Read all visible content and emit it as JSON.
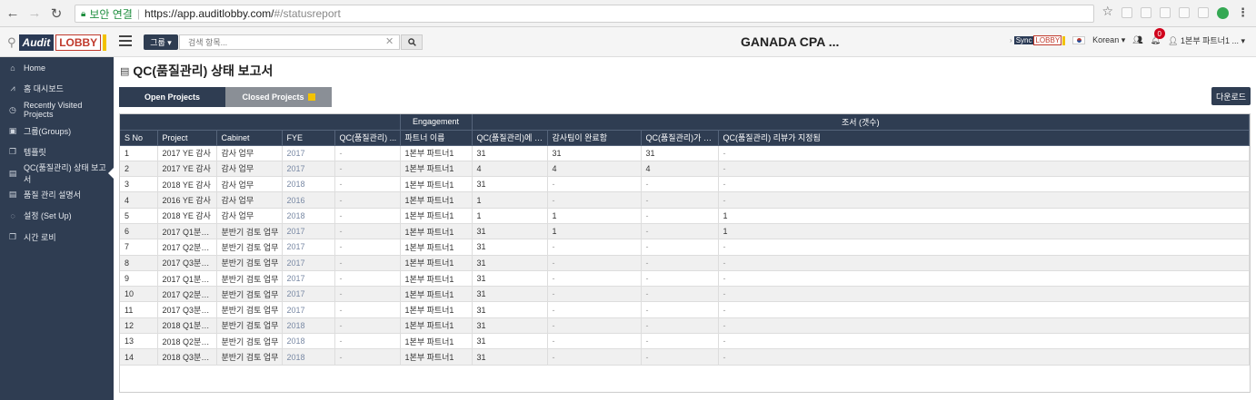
{
  "browser": {
    "secure_label": "보안 연결",
    "url_host": "https://app.auditlobby.com/",
    "url_hash": "#/statusreport"
  },
  "header": {
    "logo_audit": "Audit",
    "logo_lobby": "LOBBY",
    "group_select": "그룹 ▾",
    "search_placeholder": "검색 항목...",
    "firm_title": "GANADA CPA ...",
    "sync_prefix": "Sync",
    "sync_lobby": "LOBBY",
    "language": "Korean",
    "notification_count": "0",
    "user_name": "1본부 파트너1 ..."
  },
  "sidebar": {
    "items": [
      {
        "label": "Home",
        "icon": "home-icon",
        "glyph": "⌂"
      },
      {
        "label": "홈 대시보드",
        "icon": "chart-icon",
        "glyph": "⩘"
      },
      {
        "label": "Recently Visited Projects",
        "icon": "clock-icon",
        "glyph": "◷"
      },
      {
        "label": "그룹(Groups)",
        "icon": "group-icon",
        "glyph": "▣"
      },
      {
        "label": "템플릿",
        "icon": "template-icon",
        "glyph": "❐"
      },
      {
        "label": "QC(품질관리) 상태 보고서",
        "icon": "report-icon",
        "glyph": "▤"
      },
      {
        "label": "품질 관리 설명서",
        "icon": "manual-icon",
        "glyph": "▤"
      },
      {
        "label": "설정 (Set Up)",
        "icon": "settings-icon",
        "glyph": "◌"
      },
      {
        "label": "시간 로비",
        "icon": "time-icon",
        "glyph": "❐"
      }
    ]
  },
  "main": {
    "title": "QC(품질관리) 상태 보고서",
    "tab_open": "Open Projects",
    "tab_closed": "Closed Projects",
    "download": "다운로드",
    "group_headers": {
      "engagement": "Engagement",
      "survey": "조서 (갯수)"
    },
    "columns": [
      "S No",
      "Project",
      "Cabinet",
      "FYE",
      "QC(품질관리) ...",
      "파트너 이름",
      "QC(품질관리)에 지정...",
      "감사팀이 완료함",
      "QC(품질관리)가 리뷰...",
      "QC(품질관리) 리뷰가 지정됨"
    ],
    "rows": [
      [
        "1",
        "2017 YE 감사",
        "감사 업무",
        "2017",
        "-",
        "1본부 파트너1",
        "31",
        "31",
        "31",
        "-"
      ],
      [
        "2",
        "2017 YE 감사",
        "감사 업무",
        "2017",
        "-",
        "1본부 파트너1",
        "4",
        "4",
        "4",
        "-"
      ],
      [
        "3",
        "2018 YE 감사",
        "감사 업무",
        "2018",
        "-",
        "1본부 파트너1",
        "31",
        "-",
        "-",
        "-"
      ],
      [
        "4",
        "2016 YE 감사",
        "감사 업무",
        "2016",
        "-",
        "1본부 파트너1",
        "1",
        "-",
        "-",
        "-"
      ],
      [
        "5",
        "2018 YE 감사",
        "감사 업무",
        "2018",
        "-",
        "1본부 파트너1",
        "1",
        "1",
        "-",
        "1"
      ],
      [
        "6",
        "2017 Q1분기 ...",
        "분반기 검토 업무",
        "2017",
        "-",
        "1본부 파트너1",
        "31",
        "1",
        "-",
        "1"
      ],
      [
        "7",
        "2017 Q2분기 ...",
        "분반기 검토 업무",
        "2017",
        "-",
        "1본부 파트너1",
        "31",
        "-",
        "-",
        "-"
      ],
      [
        "8",
        "2017 Q3분기 ...",
        "분반기 검토 업무",
        "2017",
        "-",
        "1본부 파트너1",
        "31",
        "-",
        "-",
        "-"
      ],
      [
        "9",
        "2017 Q1분기 ...",
        "분반기 검토 업무",
        "2017",
        "-",
        "1본부 파트너1",
        "31",
        "-",
        "-",
        "-"
      ],
      [
        "10",
        "2017 Q2분기 ...",
        "분반기 검토 업무",
        "2017",
        "-",
        "1본부 파트너1",
        "31",
        "-",
        "-",
        "-"
      ],
      [
        "11",
        "2017 Q3분기 ...",
        "분반기 검토 업무",
        "2017",
        "-",
        "1본부 파트너1",
        "31",
        "-",
        "-",
        "-"
      ],
      [
        "12",
        "2018 Q1분기 ...",
        "분반기 검토 업무",
        "2018",
        "-",
        "1본부 파트너1",
        "31",
        "-",
        "-",
        "-"
      ],
      [
        "13",
        "2018 Q2분기 ...",
        "분반기 검토 업무",
        "2018",
        "-",
        "1본부 파트너1",
        "31",
        "-",
        "-",
        "-"
      ],
      [
        "14",
        "2018 Q3분기 ...",
        "분반기 검토 업무",
        "2018",
        "-",
        "1본부 파트너1",
        "31",
        "-",
        "-",
        "-"
      ]
    ]
  }
}
